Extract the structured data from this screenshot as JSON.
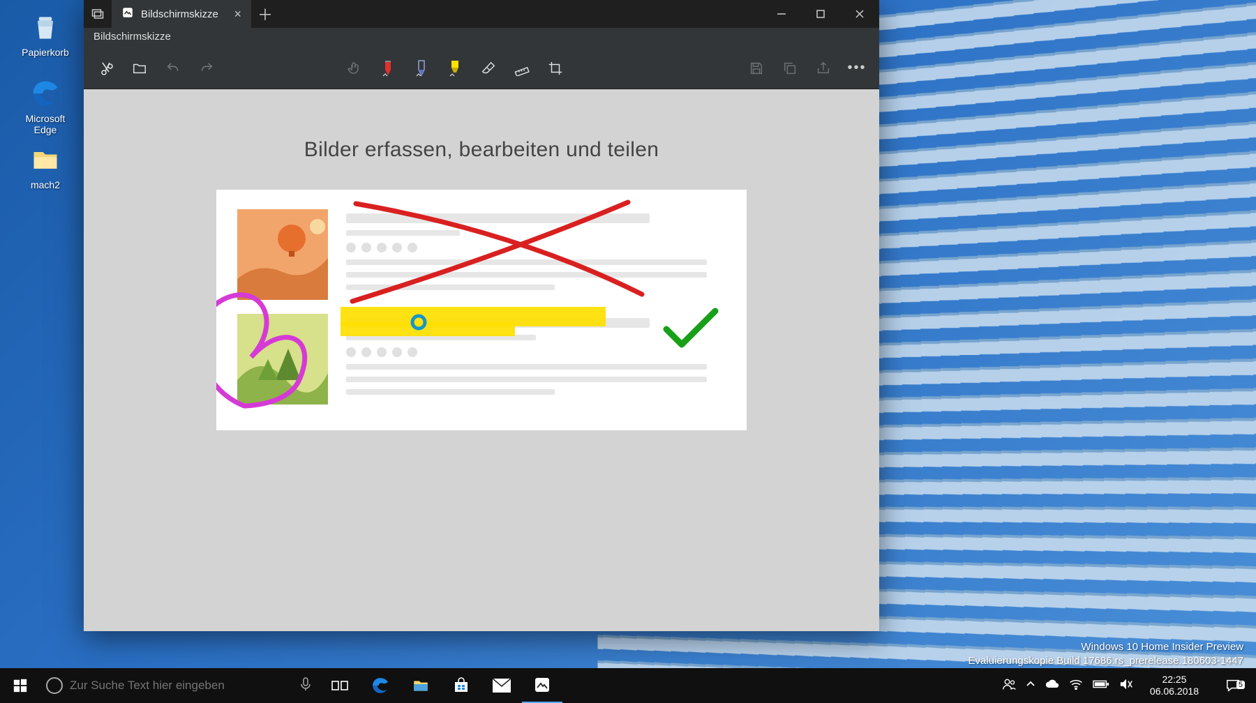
{
  "desktop": {
    "recycle_label": "Papierkorb",
    "edge_label": "Microsoft Edge",
    "folder_label": "mach2"
  },
  "app": {
    "tab_title": "Bildschirmskizze",
    "subtitle": "Bildschirmskizze",
    "canvas_title": "Bilder erfassen, bearbeiten und teilen",
    "tools": {
      "new_snip": "Neu",
      "open": "Öffnen",
      "undo": "Rückgängig",
      "redo": "Wiederholen",
      "touch": "Touchschreiben",
      "pen_red": "Kugelschreiber",
      "pen_blue": "Bleistift",
      "highlighter": "Textmarker",
      "eraser": "Radierer",
      "ruler": "Lineal",
      "crop": "Zuschneiden",
      "save": "Speichern",
      "copy": "Kopieren",
      "share": "Teilen",
      "more": "Mehr"
    },
    "window": {
      "minimize": "Minimieren",
      "maximize": "Maximieren",
      "close": "Schließen"
    }
  },
  "taskbar": {
    "search_placeholder": "Zur Suche Text hier eingeben"
  },
  "tray": {
    "time": "22:25",
    "date": "06.06.2018",
    "notif_count": "5"
  },
  "watermark": {
    "line1": "Windows 10 Home Insider Preview",
    "line2": "Evaluierungskopie Build 17686.rs_prerelease.180603-1447"
  },
  "colors": {
    "pen_red": "#e03030",
    "pen_blue": "#6070c0",
    "highlighter": "#ffe000",
    "x_stroke": "#d92020",
    "heart": "#d63ad6",
    "check": "#18a018"
  }
}
